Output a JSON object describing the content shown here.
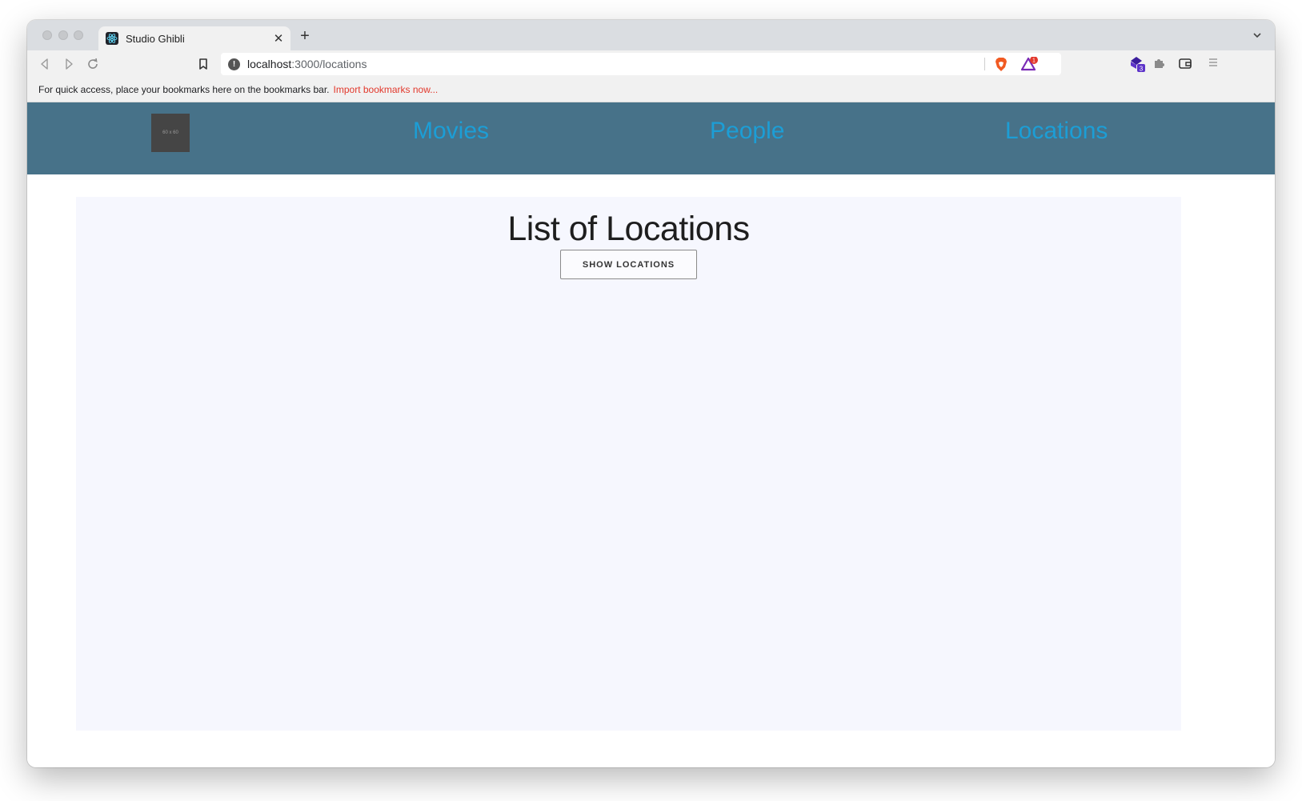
{
  "browser": {
    "tab": {
      "title": "Studio Ghibli"
    },
    "url": {
      "host": "localhost",
      "path": ":3000/locations"
    },
    "rewards_badge": "1",
    "extension_badge": "3",
    "bookmarks_bar": {
      "message": "For quick access, place your bookmarks here on the bookmarks bar.",
      "link": "Import bookmarks now..."
    }
  },
  "app": {
    "header": {
      "logo_text": "60 x 60",
      "nav": [
        {
          "label": "Movies"
        },
        {
          "label": "People"
        },
        {
          "label": "Locations"
        }
      ],
      "background_color": "#477289",
      "link_color": "#1c9ed6"
    },
    "main": {
      "title": "List of Locations",
      "button_label": "SHOW LOCATIONS",
      "background_color": "#f6f7fe"
    }
  }
}
